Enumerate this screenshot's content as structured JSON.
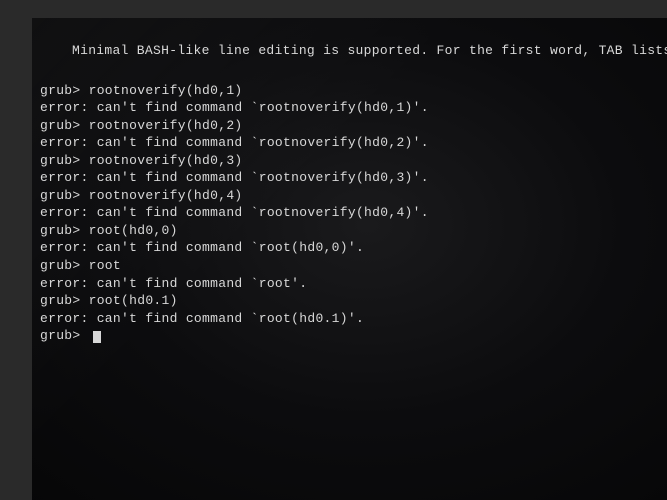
{
  "header": "Minimal BASH-like line editing is supported. For the first word, TAB lists possible",
  "prompt": "grub> ",
  "lines": [
    {
      "type": "cmd",
      "text": "rootnoverify(hd0,1)"
    },
    {
      "type": "err",
      "text": "error: can't find command `rootnoverify(hd0,1)'."
    },
    {
      "type": "cmd",
      "text": "rootnoverify(hd0,2)"
    },
    {
      "type": "err",
      "text": "error: can't find command `rootnoverify(hd0,2)'."
    },
    {
      "type": "cmd",
      "text": "rootnoverify(hd0,3)"
    },
    {
      "type": "err",
      "text": "error: can't find command `rootnoverify(hd0,3)'."
    },
    {
      "type": "cmd",
      "text": "rootnoverify(hd0,4)"
    },
    {
      "type": "err",
      "text": "error: can't find command `rootnoverify(hd0,4)'."
    },
    {
      "type": "cmd",
      "text": "root(hd0,0)"
    },
    {
      "type": "err",
      "text": "error: can't find command `root(hd0,0)'."
    },
    {
      "type": "cmd",
      "text": "root"
    },
    {
      "type": "err",
      "text": "error: can't find command `root'."
    },
    {
      "type": "cmd",
      "text": "root(hd0.1)"
    },
    {
      "type": "err",
      "text": "error: can't find command `root(hd0.1)'."
    }
  ]
}
